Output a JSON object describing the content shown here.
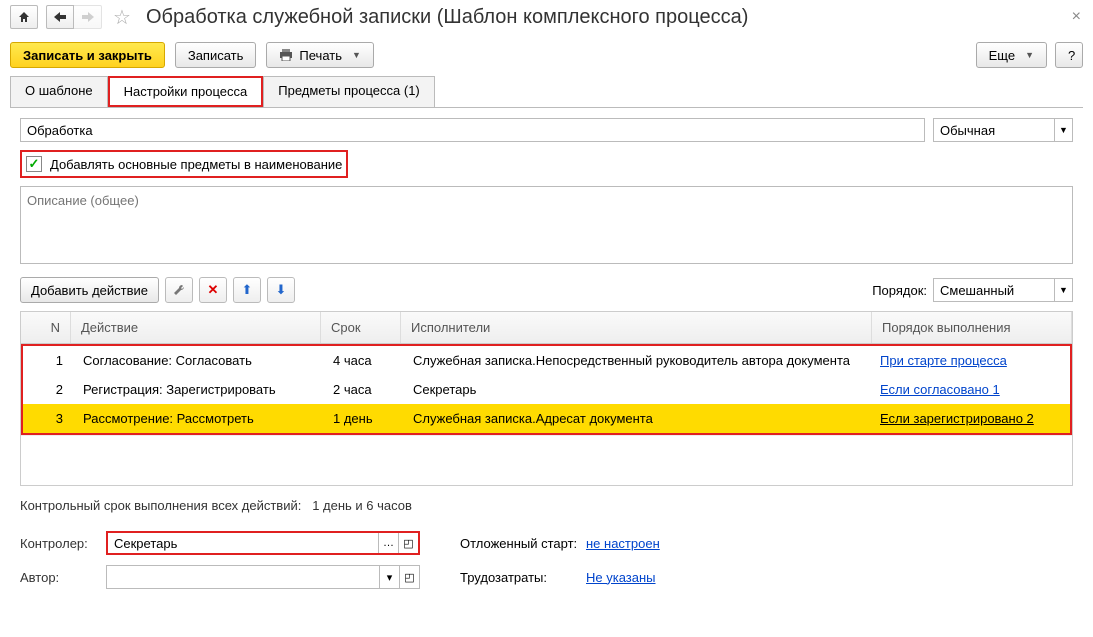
{
  "header": {
    "title": "Обработка служебной записки (Шаблон комплексного процесса)"
  },
  "toolbar": {
    "save_close": "Записать и закрыть",
    "save": "Записать",
    "print": "Печать",
    "more": "Еще"
  },
  "tabs": {
    "about": "О шаблоне",
    "settings": "Настройки процесса",
    "subjects": "Предметы процесса (1)"
  },
  "form": {
    "name_value": "Обработка",
    "importance": "Обычная",
    "add_subjects_label": "Добавлять основные предметы в наименование",
    "description_placeholder": "Описание (общее)"
  },
  "actions_bar": {
    "add_action": "Добавить действие",
    "order_label": "Порядок:",
    "order_value": "Смешанный"
  },
  "grid": {
    "headers": {
      "n": "N",
      "action": "Действие",
      "deadline": "Срок",
      "executors": "Исполнители",
      "order": "Порядок выполнения"
    },
    "rows": [
      {
        "n": "1",
        "action": "Согласование: Согласовать",
        "deadline": "4 часа",
        "executors": "Служебная записка.Непосредственный руководитель автора документа",
        "order": "При старте процесса"
      },
      {
        "n": "2",
        "action": "Регистрация: Зарегистрировать",
        "deadline": "2 часа",
        "executors": "Секретарь",
        "order": "Если согласовано 1"
      },
      {
        "n": "3",
        "action": "Рассмотрение: Рассмотреть",
        "deadline": "1 день",
        "executors": "Служебная записка.Адресат документа",
        "order": "Если зарегистрировано 2"
      }
    ]
  },
  "summary": {
    "label": "Контрольный срок выполнения всех действий:",
    "value": "1 день и 6 часов"
  },
  "bottom": {
    "controller_label": "Контролер:",
    "controller_value": "Секретарь",
    "author_label": "Автор:",
    "author_value": "",
    "delayed_label": "Отложенный старт:",
    "delayed_value": "не настроен",
    "effort_label": "Трудозатраты:",
    "effort_value": "Не указаны"
  }
}
